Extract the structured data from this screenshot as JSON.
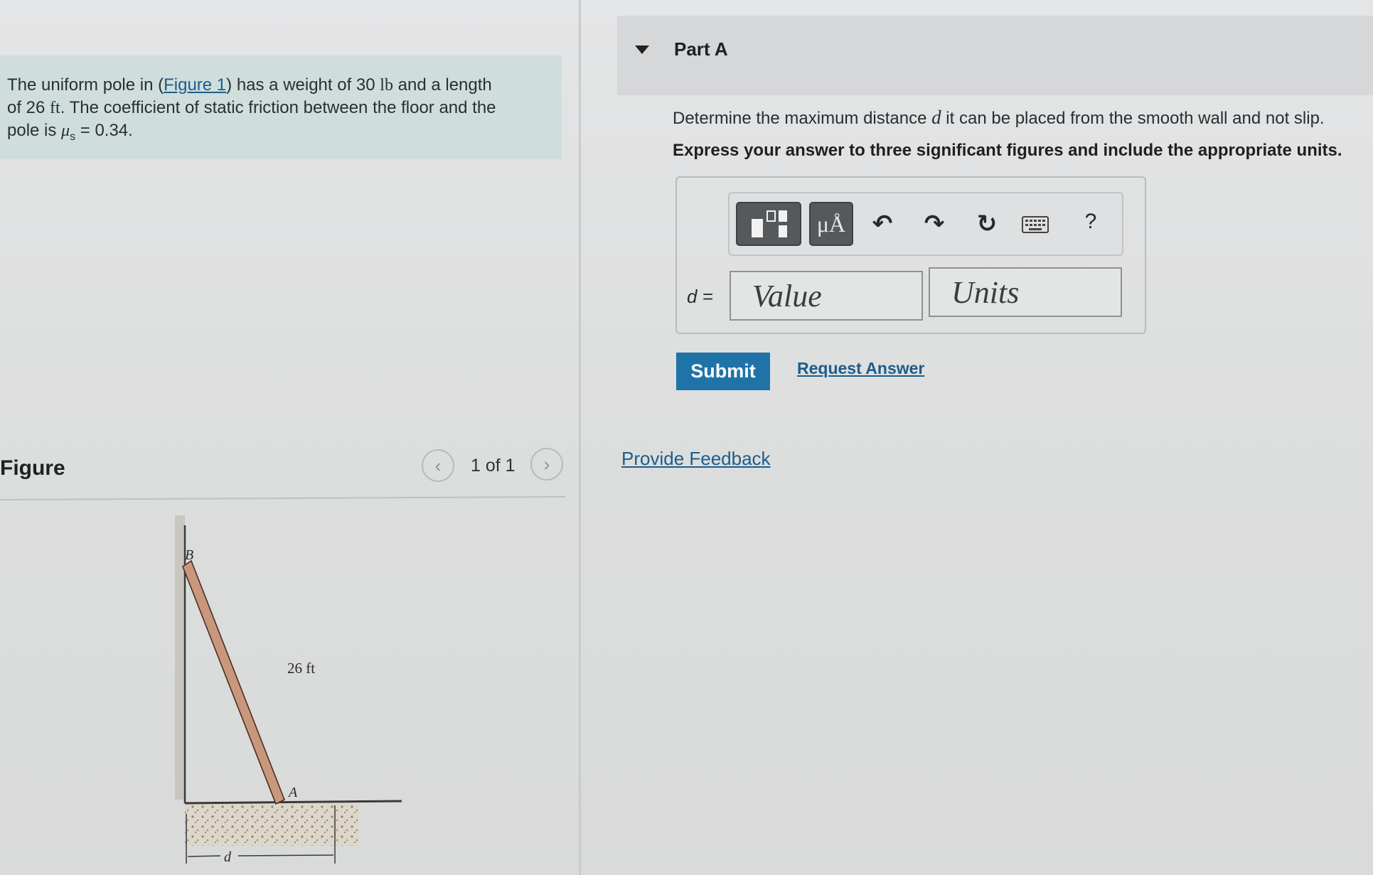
{
  "problem": {
    "text_1": "The uniform pole in (",
    "figure_link": "Figure 1",
    "text_2": ") has a weight of 30 ",
    "unit_lb": "lb",
    "text_3": " and a length",
    "text_4": "of 26 ",
    "unit_ft": "ft",
    "text_5": ". The coefficient of static friction between the floor and the",
    "text_6": "pole is ",
    "mu": "μ",
    "mu_sub": "s",
    "text_7": " = 0.34."
  },
  "figure_panel": {
    "title": "Figure",
    "pager": "1 of 1",
    "prev_icon": "chevron-left-icon",
    "next_icon": "chevron-right-icon",
    "label_B": "B",
    "label_A": "A",
    "label_length": "26 ft",
    "label_d": "d"
  },
  "part": {
    "title": "Part A",
    "question_1": "Determine the maximum distance ",
    "question_var": "d",
    "question_2": " it can be placed from the smooth wall and not slip.",
    "instruction": "Express your answer to three significant figures and include the appropriate units."
  },
  "toolbar": {
    "units_button": "μÅ",
    "help": "?",
    "icons": [
      "templates-icon",
      "units-icon",
      "undo-icon",
      "redo-icon",
      "reset-icon",
      "keyboard-icon",
      "help-icon"
    ]
  },
  "answer": {
    "label": "d =",
    "value_placeholder": "Value",
    "units_placeholder": "Units"
  },
  "actions": {
    "submit": "Submit",
    "request_answer": "Request Answer",
    "provide_feedback": "Provide Feedback"
  },
  "colors": {
    "accent": "#1f73a7",
    "link": "#1d5d8c",
    "problem_bg": "#cfdedd",
    "pole": "#c9977c"
  }
}
